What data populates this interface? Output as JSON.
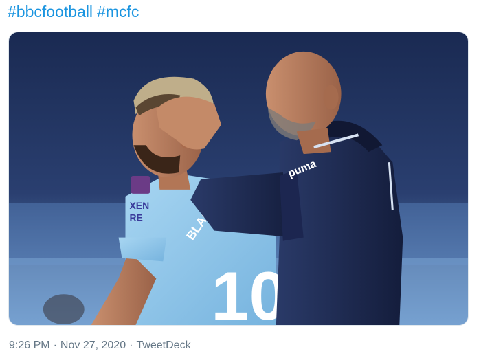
{
  "tweet": {
    "hashtags": [
      "#bbcfootball",
      "#mcfc"
    ],
    "media": {
      "kind": "photo",
      "shirt_text_brand": "XEN\nRE",
      "shirt_back_name": "BLAC",
      "shirt_number": "10",
      "jacket_text": "puma"
    },
    "time": "9:26 PM",
    "date": "Nov 27, 2020",
    "separator": "·",
    "source": "TweetDeck"
  },
  "colors": {
    "link": "#1b95e0",
    "meta": "#657786",
    "sky_blue_shirt": "#8cc5e8",
    "navy_jacket": "#1e2a4e",
    "stadium_blue": "#1c2c55"
  }
}
